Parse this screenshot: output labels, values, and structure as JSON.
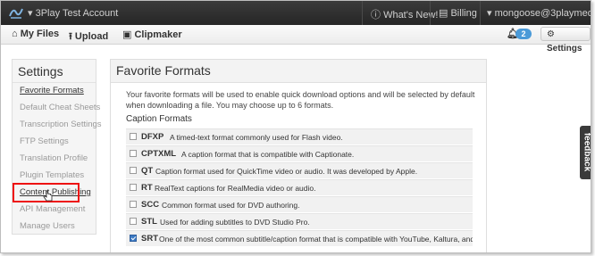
{
  "topbar": {
    "account": "▾ 3Play Test Account",
    "whats_new": "What's New!",
    "billing": "Billing",
    "user_email": "▾ mongoose@3playmedia.com"
  },
  "subbar": {
    "my_files": "My Files",
    "upload": "Upload",
    "clipmaker": "Clipmaker",
    "notification_count": "2",
    "settings": "Settings"
  },
  "sidebar": {
    "title": "Settings",
    "items": [
      {
        "label": "Favorite Formats"
      },
      {
        "label": "Default Cheat Sheets"
      },
      {
        "label": "Transcription Settings"
      },
      {
        "label": "FTP Settings"
      },
      {
        "label": "Translation Profile"
      },
      {
        "label": "Plugin Templates"
      },
      {
        "label": "Content Publishing"
      },
      {
        "label": "API Management"
      },
      {
        "label": "Manage Users"
      }
    ]
  },
  "main": {
    "title": "Favorite Formats",
    "intro": "Your favorite formats will be used to enable quick download options and will be selected by default when downloading a file. You may choose up to 6 formats.",
    "section_title": "Caption Formats",
    "formats": [
      {
        "code": "DFXP",
        "desc": "A timed-text format commonly used for Flash video.",
        "checked": false
      },
      {
        "code": "CPTXML",
        "desc": "A caption format that is compatible with Captionate.",
        "checked": false
      },
      {
        "code": "QT",
        "desc": "Caption format used for QuickTime video or audio. It was developed by Apple.",
        "checked": false
      },
      {
        "code": "RT",
        "desc": "RealText captions for RealMedia video or audio.",
        "checked": false
      },
      {
        "code": "SCC",
        "desc": "Common format used for DVD authoring.",
        "checked": false
      },
      {
        "code": "STL",
        "desc": "Used for adding subtitles to DVD Studio Pro.",
        "checked": false
      },
      {
        "code": "SRT",
        "desc": "One of the most common subtitle/caption format that is compatible with YouTube, Kaltura, and Flowplayer.",
        "checked": true
      }
    ]
  },
  "feedback": "feedback",
  "colors": {
    "topbar": "#2e2e2e",
    "badge": "#4a9ad8",
    "highlight": "#ee1111",
    "checkbox_checked": "#3b79c3"
  }
}
